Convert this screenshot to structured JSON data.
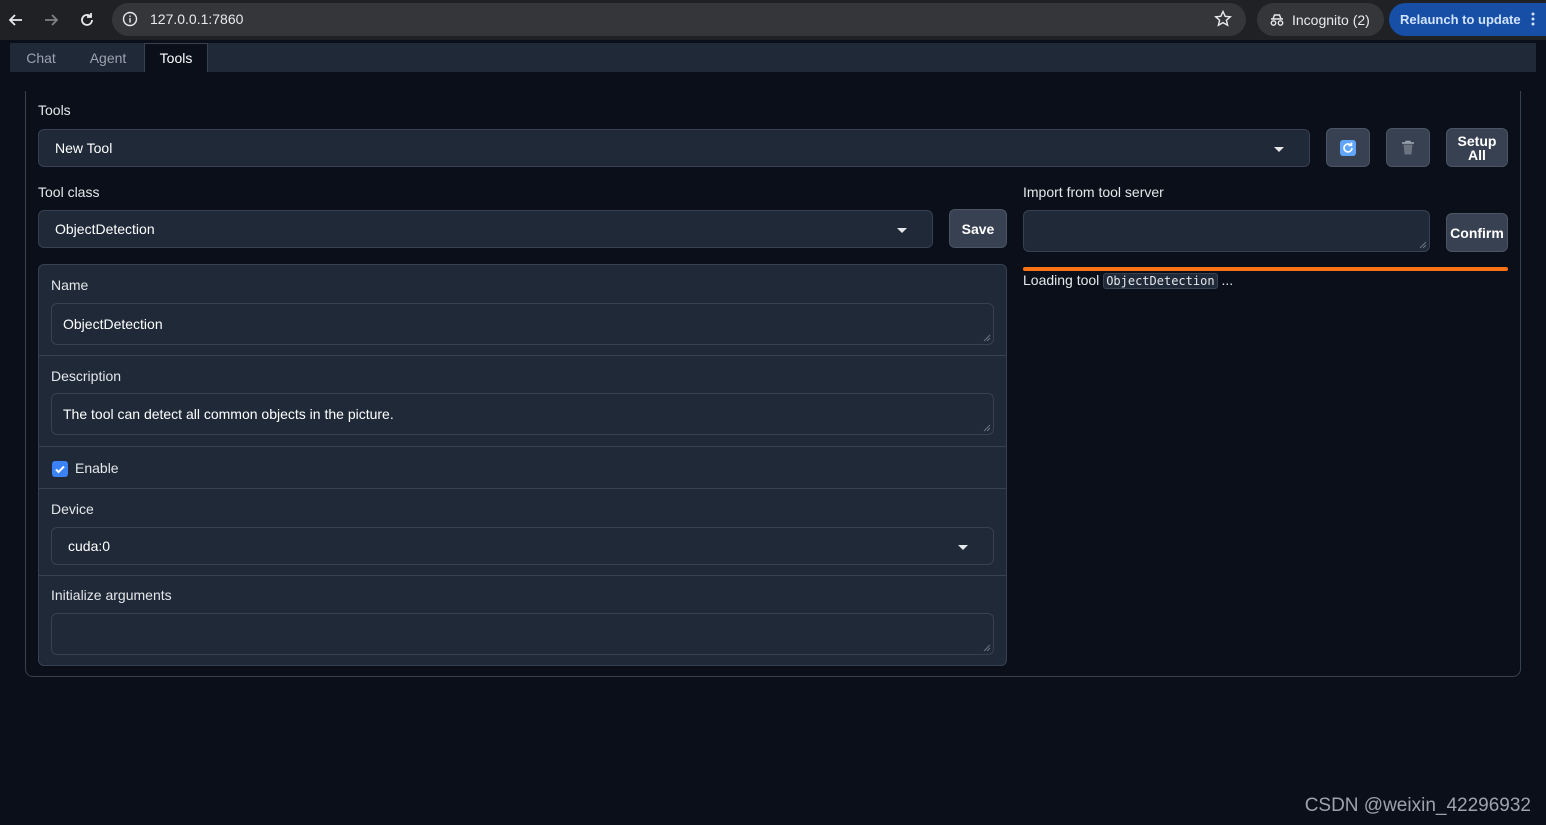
{
  "browser": {
    "url": "127.0.0.1:7860",
    "incognito_label": "Incognito (2)",
    "relaunch_label": "Relaunch to update"
  },
  "tabs": [
    {
      "label": "Chat"
    },
    {
      "label": "Agent"
    },
    {
      "label": "Tools",
      "active": true
    }
  ],
  "tools_section": {
    "label": "Tools",
    "selected": "New Tool",
    "refresh_icon": "refresh-icon",
    "delete_icon": "trash-icon",
    "setup_all_label": "Setup All"
  },
  "tool_class": {
    "label": "Tool class",
    "selected": "ObjectDetection",
    "save_label": "Save"
  },
  "form": {
    "name_label": "Name",
    "name_value": "ObjectDetection",
    "description_label": "Description",
    "description_value": "The tool can detect all common objects in the picture.",
    "enable_label": "Enable",
    "enable_checked": true,
    "device_label": "Device",
    "device_value": "cuda:0",
    "init_args_label": "Initialize arguments",
    "init_args_value": ""
  },
  "import": {
    "label": "Import from tool server",
    "value": "",
    "confirm_label": "Confirm",
    "loading_prefix": "Loading tool",
    "loading_tool": "ObjectDetection",
    "loading_suffix": "..."
  },
  "watermark": "CSDN @weixin_42296932",
  "colors": {
    "background": "#0b0f19",
    "panel": "#1f2937",
    "accent_progress": "#f97316",
    "checkbox": "#3b82f6",
    "relaunch": "#174ea6"
  }
}
